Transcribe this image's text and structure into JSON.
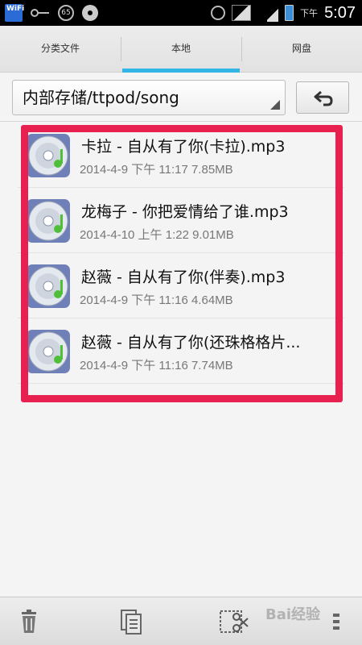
{
  "status_bar": {
    "wifi_label": "WiFi",
    "badge_number": "65",
    "ampm": "下午",
    "time": "5:07",
    "icons": [
      "wifi-icon",
      "key-icon",
      "badge-icon",
      "disc-icon",
      "alarm-icon",
      "signal-icon",
      "network-icon",
      "battery-icon"
    ]
  },
  "tabs": [
    {
      "label": "分类文件",
      "active": false
    },
    {
      "label": "本地",
      "active": true
    },
    {
      "label": "网盘",
      "active": false
    }
  ],
  "path": {
    "value": "内部存储/ttpod/song"
  },
  "files": [
    {
      "name": "卡拉 - 自从有了你(卡拉).mp3",
      "meta": "2014-4-9 下午 11:17 7.85MB"
    },
    {
      "name": "龙梅子 - 你把爱情给了谁.mp3",
      "meta": "2014-4-10 上午 1:22 9.01MB"
    },
    {
      "name": "赵薇 - 自从有了你(伴奏).mp3",
      "meta": "2014-4-9 下午 11:16 4.64MB"
    },
    {
      "name": "赵薇 - 自从有了你(还珠格格片...",
      "meta": "2014-4-9 下午 11:16 7.74MB"
    }
  ],
  "watermark": "Bai经验",
  "colors": {
    "accent_tab": "#33b5e5",
    "highlight": "#e8204f",
    "statusbar": "#000000"
  }
}
